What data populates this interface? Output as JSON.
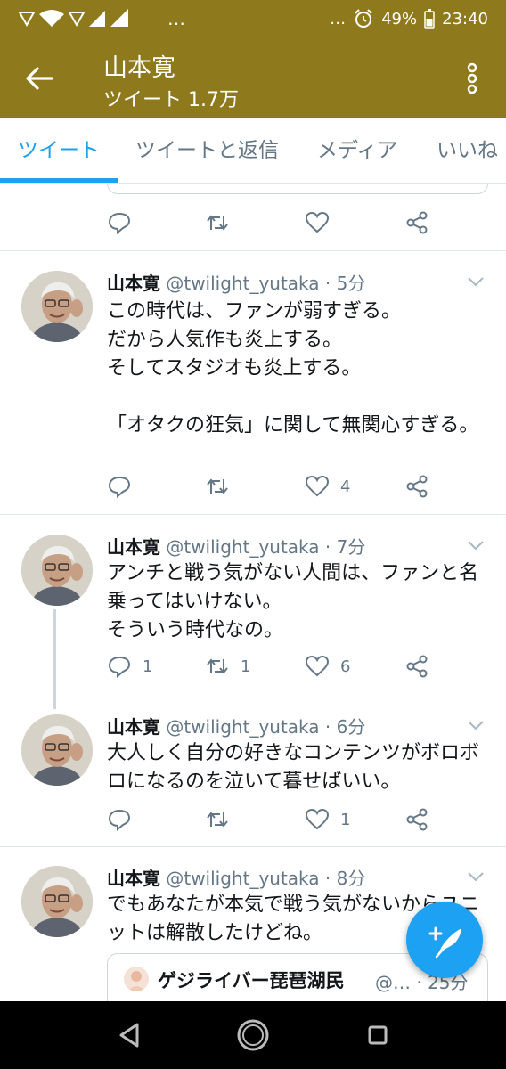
{
  "status_bar": {
    "battery": "49%",
    "time": "23:40",
    "ellipsis_left": "…",
    "ellipsis_right": "…"
  },
  "app_bar": {
    "title": "山本寛",
    "subtitle": "ツイート 1.7万"
  },
  "tabs": [
    {
      "label": "ツイート",
      "active": true
    },
    {
      "label": "ツイートと返信",
      "active": false
    },
    {
      "label": "メディア",
      "active": false
    },
    {
      "label": "いいね",
      "active": false
    }
  ],
  "tweets": [
    {
      "name": "山本寛",
      "handle": "@twilight_yutaka · 5分",
      "text": "この時代は、ファンが弱すぎる。\nだから人気作も炎上する。\nそしてスタジオも炎上する。\n\n「オタクの狂気」に関して無関心すぎる。",
      "replies": "",
      "retweets": "",
      "likes": "4"
    },
    {
      "name": "山本寛",
      "handle": "@twilight_yutaka · 7分",
      "text": "アンチと戦う気がない人間は、ファンと名乗ってはいけない。\nそういう時代なの。",
      "replies": "1",
      "retweets": "1",
      "likes": "6"
    },
    {
      "name": "山本寛",
      "handle": "@twilight_yutaka · 6分",
      "text": "大人しく自分の好きなコンテンツがボロボロになるのを泣いて暮せばいい。",
      "replies": "",
      "retweets": "",
      "likes": "1"
    },
    {
      "name": "山本寛",
      "handle": "@twilight_yutaka · 8分",
      "text": "でもあなたが本気で戦う気がないからユニットは解散したけどね。"
    }
  ],
  "quote": {
    "name": "ゲジライバー琵琶湖民",
    "handle": "@… · 25分"
  },
  "colors": {
    "header": "#8e7a1c",
    "accent": "#1da1f2",
    "muted": "#657786"
  }
}
